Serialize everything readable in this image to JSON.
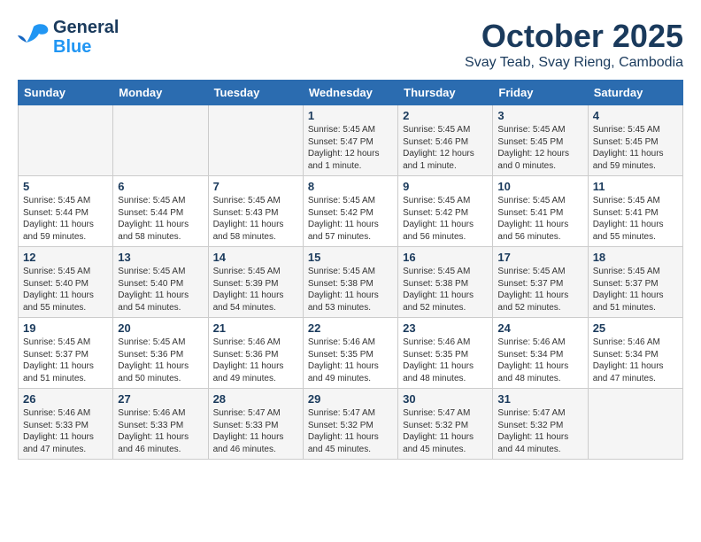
{
  "header": {
    "logo_line1": "General",
    "logo_line2": "Blue",
    "month": "October 2025",
    "location": "Svay Teab, Svay Rieng, Cambodia"
  },
  "days_of_week": [
    "Sunday",
    "Monday",
    "Tuesday",
    "Wednesday",
    "Thursday",
    "Friday",
    "Saturday"
  ],
  "weeks": [
    [
      {
        "day": "",
        "content": ""
      },
      {
        "day": "",
        "content": ""
      },
      {
        "day": "",
        "content": ""
      },
      {
        "day": "1",
        "content": "Sunrise: 5:45 AM\nSunset: 5:47 PM\nDaylight: 12 hours\nand 1 minute."
      },
      {
        "day": "2",
        "content": "Sunrise: 5:45 AM\nSunset: 5:46 PM\nDaylight: 12 hours\nand 1 minute."
      },
      {
        "day": "3",
        "content": "Sunrise: 5:45 AM\nSunset: 5:45 PM\nDaylight: 12 hours\nand 0 minutes."
      },
      {
        "day": "4",
        "content": "Sunrise: 5:45 AM\nSunset: 5:45 PM\nDaylight: 11 hours\nand 59 minutes."
      }
    ],
    [
      {
        "day": "5",
        "content": "Sunrise: 5:45 AM\nSunset: 5:44 PM\nDaylight: 11 hours\nand 59 minutes."
      },
      {
        "day": "6",
        "content": "Sunrise: 5:45 AM\nSunset: 5:44 PM\nDaylight: 11 hours\nand 58 minutes."
      },
      {
        "day": "7",
        "content": "Sunrise: 5:45 AM\nSunset: 5:43 PM\nDaylight: 11 hours\nand 58 minutes."
      },
      {
        "day": "8",
        "content": "Sunrise: 5:45 AM\nSunset: 5:42 PM\nDaylight: 11 hours\nand 57 minutes."
      },
      {
        "day": "9",
        "content": "Sunrise: 5:45 AM\nSunset: 5:42 PM\nDaylight: 11 hours\nand 56 minutes."
      },
      {
        "day": "10",
        "content": "Sunrise: 5:45 AM\nSunset: 5:41 PM\nDaylight: 11 hours\nand 56 minutes."
      },
      {
        "day": "11",
        "content": "Sunrise: 5:45 AM\nSunset: 5:41 PM\nDaylight: 11 hours\nand 55 minutes."
      }
    ],
    [
      {
        "day": "12",
        "content": "Sunrise: 5:45 AM\nSunset: 5:40 PM\nDaylight: 11 hours\nand 55 minutes."
      },
      {
        "day": "13",
        "content": "Sunrise: 5:45 AM\nSunset: 5:40 PM\nDaylight: 11 hours\nand 54 minutes."
      },
      {
        "day": "14",
        "content": "Sunrise: 5:45 AM\nSunset: 5:39 PM\nDaylight: 11 hours\nand 54 minutes."
      },
      {
        "day": "15",
        "content": "Sunrise: 5:45 AM\nSunset: 5:38 PM\nDaylight: 11 hours\nand 53 minutes."
      },
      {
        "day": "16",
        "content": "Sunrise: 5:45 AM\nSunset: 5:38 PM\nDaylight: 11 hours\nand 52 minutes."
      },
      {
        "day": "17",
        "content": "Sunrise: 5:45 AM\nSunset: 5:37 PM\nDaylight: 11 hours\nand 52 minutes."
      },
      {
        "day": "18",
        "content": "Sunrise: 5:45 AM\nSunset: 5:37 PM\nDaylight: 11 hours\nand 51 minutes."
      }
    ],
    [
      {
        "day": "19",
        "content": "Sunrise: 5:45 AM\nSunset: 5:37 PM\nDaylight: 11 hours\nand 51 minutes."
      },
      {
        "day": "20",
        "content": "Sunrise: 5:45 AM\nSunset: 5:36 PM\nDaylight: 11 hours\nand 50 minutes."
      },
      {
        "day": "21",
        "content": "Sunrise: 5:46 AM\nSunset: 5:36 PM\nDaylight: 11 hours\nand 49 minutes."
      },
      {
        "day": "22",
        "content": "Sunrise: 5:46 AM\nSunset: 5:35 PM\nDaylight: 11 hours\nand 49 minutes."
      },
      {
        "day": "23",
        "content": "Sunrise: 5:46 AM\nSunset: 5:35 PM\nDaylight: 11 hours\nand 48 minutes."
      },
      {
        "day": "24",
        "content": "Sunrise: 5:46 AM\nSunset: 5:34 PM\nDaylight: 11 hours\nand 48 minutes."
      },
      {
        "day": "25",
        "content": "Sunrise: 5:46 AM\nSunset: 5:34 PM\nDaylight: 11 hours\nand 47 minutes."
      }
    ],
    [
      {
        "day": "26",
        "content": "Sunrise: 5:46 AM\nSunset: 5:33 PM\nDaylight: 11 hours\nand 47 minutes."
      },
      {
        "day": "27",
        "content": "Sunrise: 5:46 AM\nSunset: 5:33 PM\nDaylight: 11 hours\nand 46 minutes."
      },
      {
        "day": "28",
        "content": "Sunrise: 5:47 AM\nSunset: 5:33 PM\nDaylight: 11 hours\nand 46 minutes."
      },
      {
        "day": "29",
        "content": "Sunrise: 5:47 AM\nSunset: 5:32 PM\nDaylight: 11 hours\nand 45 minutes."
      },
      {
        "day": "30",
        "content": "Sunrise: 5:47 AM\nSunset: 5:32 PM\nDaylight: 11 hours\nand 45 minutes."
      },
      {
        "day": "31",
        "content": "Sunrise: 5:47 AM\nSunset: 5:32 PM\nDaylight: 11 hours\nand 44 minutes."
      },
      {
        "day": "",
        "content": ""
      }
    ]
  ]
}
